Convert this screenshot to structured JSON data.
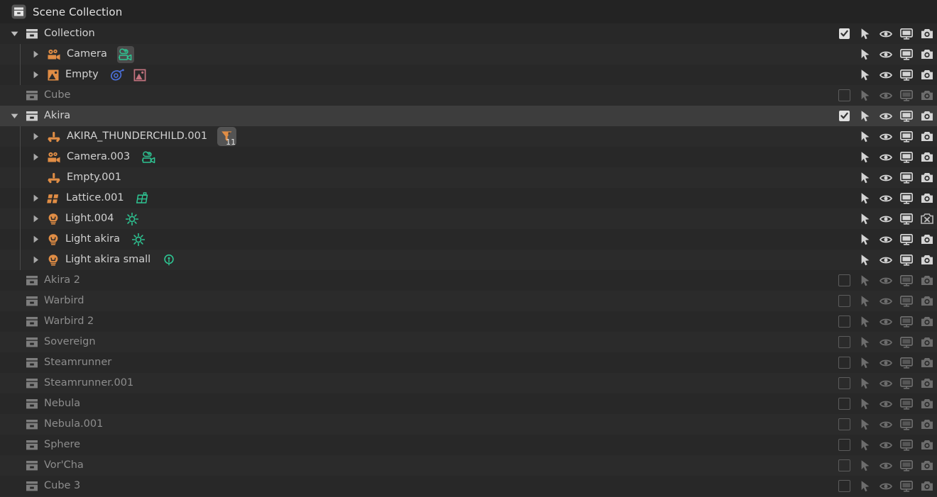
{
  "header": {
    "title": "Scene Collection",
    "icon": "collection-icon"
  },
  "colors": {
    "background": "#282828",
    "row_alt": "#2b2b2b",
    "row_selected": "#3d3d3d",
    "header_bg": "#232323",
    "object_orange": "#e08d45",
    "data_teal": "#2ec492",
    "physics_blue": "#4a6fd8",
    "image_pink": "#c4737f",
    "text": "#d2d2d2",
    "text_dim": "#8d8d8d"
  },
  "columns": {
    "checkbox": "exclude-from-view-layer",
    "selectable": "selectable-arrow-icon",
    "hide_viewport": "eye-icon",
    "disable_viewports": "monitor-icon",
    "disable_renders": "camera-icon"
  },
  "rows": [
    {
      "name": "Collection",
      "indent": 1,
      "type_icon": "collection-icon",
      "disclosure": "open",
      "dim": false,
      "selected": false,
      "treeline": false,
      "checkbox": "checked",
      "render_icon": "camera-icon",
      "dimmed_controls": false,
      "data_icons": []
    },
    {
      "name": "Camera",
      "indent": 2,
      "type_icon": "camera-object-icon",
      "disclosure": "closed",
      "dim": false,
      "selected": false,
      "treeline": true,
      "checkbox": "none",
      "render_icon": "camera-icon",
      "dimmed_controls": false,
      "data_icons": [
        {
          "icon": "camera-data-icon",
          "color": "#2ec492",
          "boxed": true
        }
      ]
    },
    {
      "name": "Empty",
      "indent": 2,
      "type_icon": "empty-image-icon",
      "disclosure": "closed",
      "dim": false,
      "selected": false,
      "treeline": true,
      "checkbox": "none",
      "render_icon": "camera-icon",
      "dimmed_controls": false,
      "data_icons": [
        {
          "icon": "force-field-icon",
          "color": "#4a6fd8",
          "boxed": false
        },
        {
          "icon": "image-data-icon",
          "color": "#c4737f",
          "boxed": false
        }
      ]
    },
    {
      "name": "Cube",
      "indent": 1,
      "type_icon": "collection-icon",
      "disclosure": "none",
      "dim": true,
      "selected": false,
      "treeline": false,
      "checkbox": "unchecked",
      "render_icon": "camera-icon",
      "dimmed_controls": true,
      "data_icons": []
    },
    {
      "name": "Akira",
      "indent": 1,
      "type_icon": "collection-icon",
      "disclosure": "open",
      "dim": false,
      "selected": true,
      "treeline": false,
      "checkbox": "checked",
      "render_icon": "camera-icon",
      "dimmed_controls": false,
      "data_icons": []
    },
    {
      "name": "AKIRA_THUNDERCHILD.001",
      "indent": 2,
      "type_icon": "empty-axis-icon",
      "disclosure": "closed",
      "dim": false,
      "selected": false,
      "treeline": true,
      "checkbox": "none",
      "render_icon": "camera-icon",
      "dimmed_controls": false,
      "data_icons": [],
      "modifier_badge": {
        "icon": "children-badge-icon",
        "count": "11"
      }
    },
    {
      "name": "Camera.003",
      "indent": 2,
      "type_icon": "camera-object-icon",
      "disclosure": "closed",
      "dim": false,
      "selected": false,
      "treeline": true,
      "checkbox": "none",
      "render_icon": "camera-icon",
      "dimmed_controls": false,
      "data_icons": [
        {
          "icon": "camera-data-icon",
          "color": "#2ec492",
          "boxed": false
        }
      ]
    },
    {
      "name": "Empty.001",
      "indent": 2,
      "type_icon": "empty-axis-icon",
      "disclosure": "none",
      "dim": false,
      "selected": false,
      "treeline": true,
      "checkbox": "none",
      "render_icon": "camera-icon",
      "dimmed_controls": false,
      "data_icons": []
    },
    {
      "name": "Lattice.001",
      "indent": 2,
      "type_icon": "lattice-object-icon",
      "disclosure": "closed",
      "dim": false,
      "selected": false,
      "treeline": true,
      "checkbox": "none",
      "render_icon": "camera-icon",
      "dimmed_controls": false,
      "data_icons": [
        {
          "icon": "lattice-data-icon",
          "color": "#2ec492",
          "boxed": false
        }
      ]
    },
    {
      "name": "Light.004",
      "indent": 2,
      "type_icon": "light-object-icon",
      "disclosure": "closed",
      "dim": false,
      "selected": false,
      "treeline": true,
      "checkbox": "none",
      "render_icon": "camera-disabled-icon",
      "dimmed_controls": false,
      "data_icons": [
        {
          "icon": "sun-light-icon",
          "color": "#2ec492",
          "boxed": false
        }
      ]
    },
    {
      "name": "Light akira",
      "indent": 2,
      "type_icon": "light-object-icon",
      "disclosure": "closed",
      "dim": false,
      "selected": false,
      "treeline": true,
      "checkbox": "none",
      "render_icon": "camera-icon",
      "dimmed_controls": false,
      "data_icons": [
        {
          "icon": "sun-light-icon",
          "color": "#2ec492",
          "boxed": false
        }
      ]
    },
    {
      "name": "Light akira small",
      "indent": 2,
      "type_icon": "light-object-icon",
      "disclosure": "closed",
      "dim": false,
      "selected": false,
      "treeline": true,
      "checkbox": "none",
      "render_icon": "camera-icon",
      "dimmed_controls": false,
      "data_icons": [
        {
          "icon": "point-light-icon",
          "color": "#2ec492",
          "boxed": false
        }
      ]
    },
    {
      "name": "Akira 2",
      "indent": 1,
      "type_icon": "collection-icon",
      "disclosure": "none",
      "dim": true,
      "selected": false,
      "treeline": false,
      "checkbox": "unchecked",
      "render_icon": "camera-icon",
      "dimmed_controls": true,
      "data_icons": []
    },
    {
      "name": "Warbird",
      "indent": 1,
      "type_icon": "collection-icon",
      "disclosure": "none",
      "dim": true,
      "selected": false,
      "treeline": false,
      "checkbox": "unchecked",
      "render_icon": "camera-icon",
      "dimmed_controls": true,
      "data_icons": []
    },
    {
      "name": "Warbird 2",
      "indent": 1,
      "type_icon": "collection-icon",
      "disclosure": "none",
      "dim": true,
      "selected": false,
      "treeline": false,
      "checkbox": "unchecked",
      "render_icon": "camera-icon",
      "dimmed_controls": true,
      "data_icons": []
    },
    {
      "name": "Sovereign",
      "indent": 1,
      "type_icon": "collection-icon",
      "disclosure": "none",
      "dim": true,
      "selected": false,
      "treeline": false,
      "checkbox": "unchecked",
      "render_icon": "camera-icon",
      "dimmed_controls": true,
      "data_icons": []
    },
    {
      "name": "Steamrunner",
      "indent": 1,
      "type_icon": "collection-icon",
      "disclosure": "none",
      "dim": true,
      "selected": false,
      "treeline": false,
      "checkbox": "unchecked",
      "render_icon": "camera-icon",
      "dimmed_controls": true,
      "data_icons": []
    },
    {
      "name": "Steamrunner.001",
      "indent": 1,
      "type_icon": "collection-icon",
      "disclosure": "none",
      "dim": true,
      "selected": false,
      "treeline": false,
      "checkbox": "unchecked",
      "render_icon": "camera-icon",
      "dimmed_controls": true,
      "data_icons": []
    },
    {
      "name": "Nebula",
      "indent": 1,
      "type_icon": "collection-icon",
      "disclosure": "none",
      "dim": true,
      "selected": false,
      "treeline": false,
      "checkbox": "unchecked",
      "render_icon": "camera-icon",
      "dimmed_controls": true,
      "data_icons": []
    },
    {
      "name": "Nebula.001",
      "indent": 1,
      "type_icon": "collection-icon",
      "disclosure": "none",
      "dim": true,
      "selected": false,
      "treeline": false,
      "checkbox": "unchecked",
      "render_icon": "camera-icon",
      "dimmed_controls": true,
      "data_icons": []
    },
    {
      "name": "Sphere",
      "indent": 1,
      "type_icon": "collection-icon",
      "disclosure": "none",
      "dim": true,
      "selected": false,
      "treeline": false,
      "checkbox": "unchecked",
      "render_icon": "camera-icon",
      "dimmed_controls": true,
      "data_icons": []
    },
    {
      "name": "Vor'Cha",
      "indent": 1,
      "type_icon": "collection-icon",
      "disclosure": "none",
      "dim": true,
      "selected": false,
      "treeline": false,
      "checkbox": "unchecked",
      "render_icon": "camera-icon",
      "dimmed_controls": true,
      "data_icons": []
    },
    {
      "name": "Cube 3",
      "indent": 1,
      "type_icon": "collection-icon",
      "disclosure": "none",
      "dim": true,
      "selected": false,
      "treeline": false,
      "checkbox": "unchecked",
      "render_icon": "camera-icon",
      "dimmed_controls": true,
      "data_icons": []
    }
  ]
}
